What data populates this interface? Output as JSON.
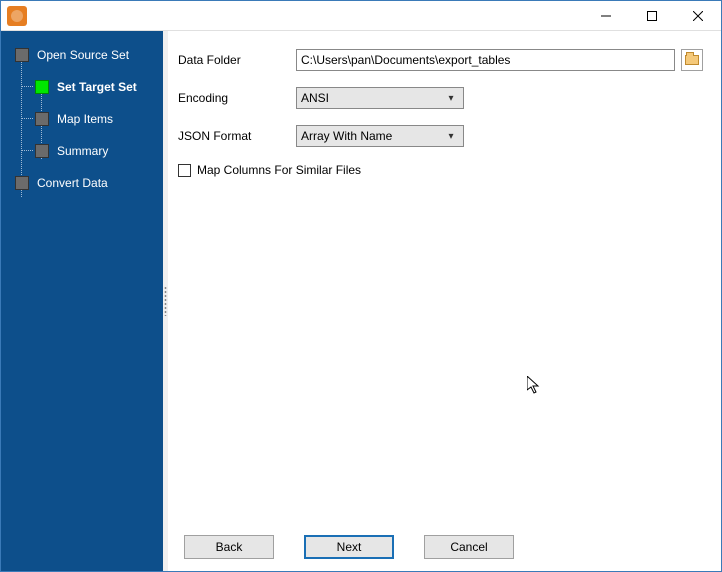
{
  "window": {
    "title": ""
  },
  "sidebar": {
    "items": [
      {
        "label": "Open Source Set",
        "level": 0,
        "active": false
      },
      {
        "label": "Set Target Set",
        "level": 1,
        "active": true
      },
      {
        "label": "Map Items",
        "level": 1,
        "active": false
      },
      {
        "label": "Summary",
        "level": 1,
        "active": false
      },
      {
        "label": "Convert Data",
        "level": 0,
        "active": false
      }
    ]
  },
  "form": {
    "data_folder_label": "Data Folder",
    "data_folder_value": "C:\\Users\\pan\\Documents\\export_tables",
    "encoding_label": "Encoding",
    "encoding_value": "ANSI",
    "json_format_label": "JSON Format",
    "json_format_value": "Array With Name",
    "map_columns_checked": false,
    "map_columns_label": "Map Columns For Similar Files"
  },
  "buttons": {
    "back": "Back",
    "next": "Next",
    "cancel": "Cancel"
  }
}
